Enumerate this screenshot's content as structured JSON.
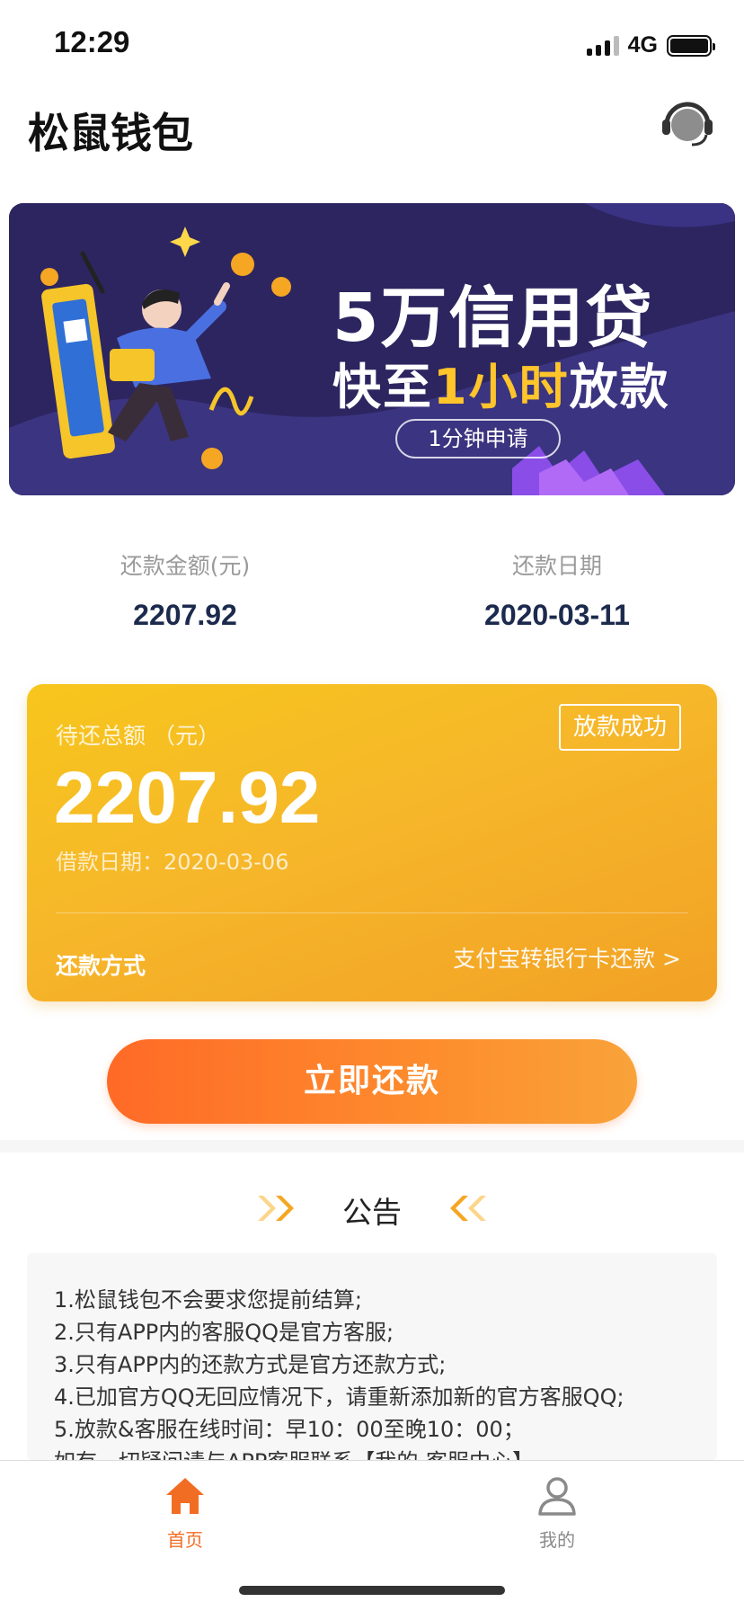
{
  "status_bar": {
    "time": "12:29",
    "network": "4G"
  },
  "header": {
    "title": "松鼠钱包",
    "support_icon": "headset-icon"
  },
  "banner": {
    "title_line1": "5万信用贷",
    "title_line2_prefix": "快至",
    "title_line2_highlight": "1小时",
    "title_line2_suffix": "放款",
    "button": "1分钟申请",
    "highlight_color": "#ffc52b",
    "background_color": "#2c2560"
  },
  "summary": {
    "amount_label": "还款金额(元)",
    "amount_value": "2207.92",
    "date_label": "还款日期",
    "date_value": "2020-03-11"
  },
  "repay_card": {
    "label": "待还总额 （元）",
    "badge": "放款成功",
    "amount": "2207.92",
    "loan_date": "借款日期：2020-03-06",
    "method_label": "还款方式",
    "method_value": "支付宝转银行卡还款 >"
  },
  "repay_button": {
    "label": "立即还款"
  },
  "notice": {
    "title": "公告",
    "lines": [
      "1.松鼠钱包不会要求您提前结算;",
      "2.只有APP内的客服QQ是官方客服;",
      "3.只有APP内的还款方式是官方还款方式;",
      "4.已加官方QQ无回应情况下，请重新添加新的官方客服QQ;",
      "5.放款&客服在线时间：早10：00至晚10：00；",
      "如有一切疑问请与APP客服联系【我的-客服中心】"
    ]
  },
  "tab_bar": {
    "home_label": "首页",
    "mine_label": "我的",
    "active_color": "#f26d24",
    "inactive_color": "#8a8a8a"
  }
}
